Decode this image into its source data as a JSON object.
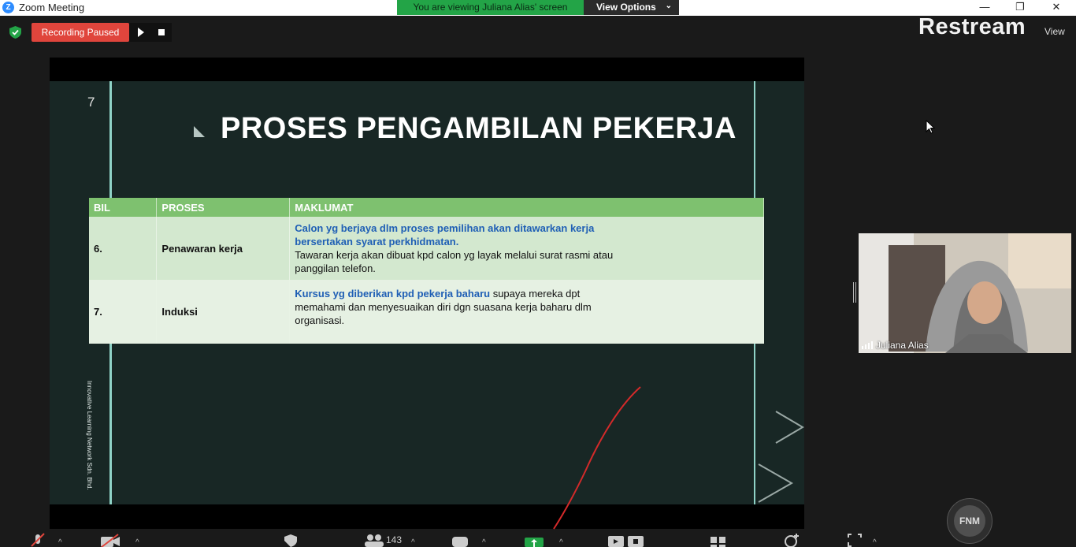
{
  "window": {
    "app_icon_letter": "Z",
    "title": "Zoom Meeting",
    "minimize": "—",
    "restore": "❐",
    "close": "✕"
  },
  "banner": {
    "viewing_text": "You are viewing Juliana Alias' screen",
    "view_options_label": "View Options",
    "view_options_chevron": "⌄"
  },
  "recording": {
    "status_label": "Recording Paused",
    "resume_icon": "play-icon",
    "stop_icon": "stop-icon"
  },
  "overlay": {
    "brand": "Restream",
    "view_label": "View"
  },
  "slide": {
    "number": "7",
    "title": "PROSES PENGAMBILAN PEKERJA",
    "table": {
      "headers": [
        "BIL",
        "PROSES",
        "MAKLUMAT"
      ],
      "rows": [
        {
          "bil": "6.",
          "proses": "Penawaran kerja",
          "maklumat_highlight": "Calon yg berjaya dlm proses pemilihan akan ditawarkan kerja bersertakan syarat perkhidmatan.",
          "maklumat_rest": "Tawaran kerja akan dibuat kpd calon yg layak melalui surat rasmi atau panggilan telefon."
        },
        {
          "bil": "7.",
          "proses": "Induksi",
          "maklumat_highlight": "Kursus yg diberikan kpd pekerja baharu",
          "maklumat_rest": " supaya mereka dpt memahami dan menyesuaikan diri dgn suasana kerja baharu dlm organisasi."
        }
      ]
    },
    "vertical_text": "Innovative Learning Network Sdn. Bhd."
  },
  "participant": {
    "name": "Juliana Alias"
  },
  "toolbar": {
    "participant_count": "143",
    "avatar_initials": "FNM"
  },
  "colors": {
    "banner_green": "#23a447",
    "recording_red": "#e0453c",
    "table_header": "#7ec16f",
    "highlight_blue": "#1f5fb5",
    "annotation_red": "#d42a2a"
  }
}
